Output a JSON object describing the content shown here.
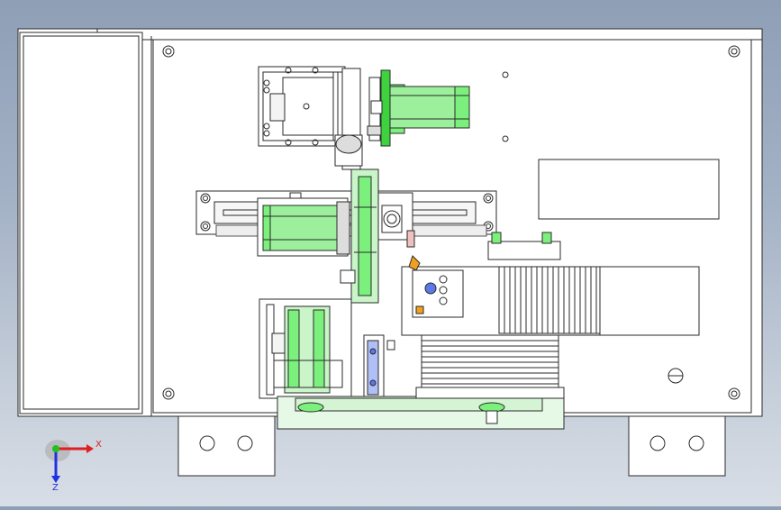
{
  "viewport": {
    "background_top": "#8e9fb6",
    "background_bottom": "#d8dee6",
    "model_line_color": "#2a2a2a",
    "panel_fill": "#ffffff",
    "green_part_color": "#7cf07c",
    "bright_green_color": "#3ed23e",
    "blue_highlight_color": "#5a7ae8",
    "orange_part_color": "#f0a020"
  },
  "axis_triad": {
    "x_label": "X",
    "z_label": "Z",
    "x_color": "#e02020",
    "y_color": "#20c020",
    "z_color": "#2030e0"
  }
}
